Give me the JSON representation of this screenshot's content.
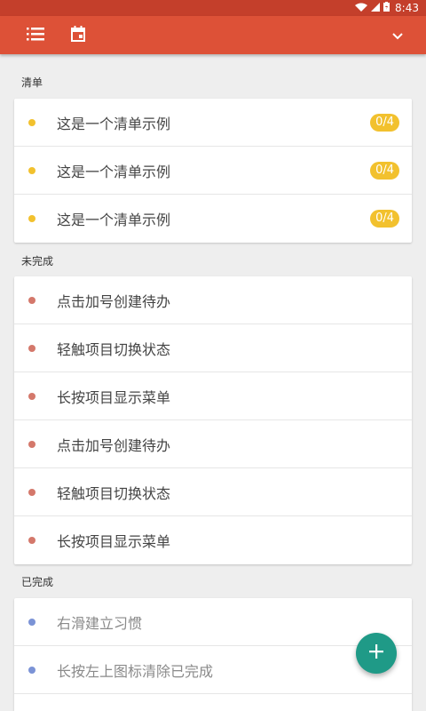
{
  "status_bar": {
    "time": "8:43",
    "icons": [
      "wifi-icon",
      "signal-icon",
      "battery-icon"
    ]
  },
  "toolbar": {
    "icons": [
      "list-menu-icon",
      "calendar-icon",
      "chevron-down-icon"
    ]
  },
  "colors": {
    "app_bar": "#dd5137",
    "status_bar": "#c43f2b",
    "badge": "#f2c12e",
    "dot_list": "#f2c12e",
    "dot_todo": "#d4786b",
    "dot_done": "#7b93d6",
    "fab": "#1f9a87"
  },
  "sections": {
    "lists": {
      "header": "清单",
      "items": [
        {
          "label": "这是一个清单示例",
          "badge": "0/4"
        },
        {
          "label": "这是一个清单示例",
          "badge": "0/4"
        },
        {
          "label": "这是一个清单示例",
          "badge": "0/4"
        }
      ]
    },
    "todo": {
      "header": "未完成",
      "items": [
        {
          "label": "点击加号创建待办"
        },
        {
          "label": "轻触项目切换状态"
        },
        {
          "label": "长按项目显示菜单"
        },
        {
          "label": "点击加号创建待办"
        },
        {
          "label": "轻触项目切换状态"
        },
        {
          "label": "长按项目显示菜单"
        }
      ]
    },
    "done": {
      "header": "已完成",
      "items": [
        {
          "label": "右滑建立习惯"
        },
        {
          "label": "长按左上图标清除已完成"
        }
      ]
    }
  },
  "fab": {
    "icon": "plus-icon"
  }
}
